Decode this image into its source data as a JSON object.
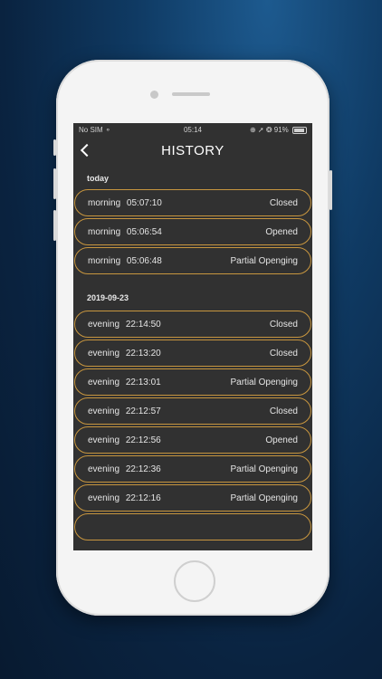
{
  "status": {
    "carrier": "No SIM",
    "time": "05:14",
    "indicators": "⊕ ➚ ❂ 91%"
  },
  "nav": {
    "title": "HISTORY"
  },
  "sections": [
    {
      "label": "today",
      "items": [
        {
          "period": "morning",
          "time": "05:07:10",
          "state": "Closed"
        },
        {
          "period": "morning",
          "time": "05:06:54",
          "state": "Opened"
        },
        {
          "period": "morning",
          "time": "05:06:48",
          "state": "Partial Openging"
        }
      ]
    },
    {
      "label": "2019-09-23",
      "items": [
        {
          "period": "evening",
          "time": "22:14:50",
          "state": "Closed"
        },
        {
          "period": "evening",
          "time": "22:13:20",
          "state": "Closed"
        },
        {
          "period": "evening",
          "time": "22:13:01",
          "state": "Partial Openging"
        },
        {
          "period": "evening",
          "time": "22:12:57",
          "state": "Closed"
        },
        {
          "period": "evening",
          "time": "22:12:56",
          "state": "Opened"
        },
        {
          "period": "evening",
          "time": "22:12:36",
          "state": "Partial Openging"
        },
        {
          "period": "evening",
          "time": "22:12:16",
          "state": "Partial Openging"
        }
      ]
    }
  ],
  "colors": {
    "row_border": "#c8963f",
    "screen_bg": "#313131"
  }
}
